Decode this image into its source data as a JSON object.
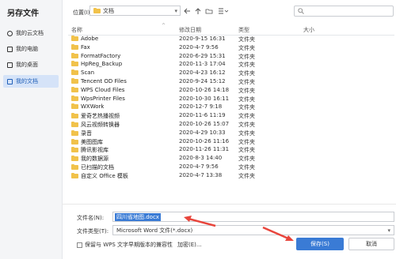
{
  "sidebar": {
    "title": "另存文件",
    "items": [
      {
        "label": "我的云文档",
        "icon": "cloud-doc-icon"
      },
      {
        "label": "我的电脑",
        "icon": "computer-icon"
      },
      {
        "label": "我的桌面",
        "icon": "desktop-icon"
      },
      {
        "label": "我的文档",
        "icon": "folder-icon",
        "active": true
      }
    ]
  },
  "toolbar": {
    "location_label": "位置(I):",
    "location_value": "文档",
    "search_placeholder": ""
  },
  "table": {
    "columns": [
      "名称",
      "修改日期",
      "类型",
      "大小"
    ],
    "rows": [
      {
        "name": "Adobe",
        "date": "2020-9-15 16:31",
        "type": "文件夹"
      },
      {
        "name": "Fax",
        "date": "2020-4-7 9:56",
        "type": "文件夹"
      },
      {
        "name": "FormatFactory",
        "date": "2020-6-29 15:31",
        "type": "文件夹"
      },
      {
        "name": "HpReg_Backup",
        "date": "2020-11-3 17:04",
        "type": "文件夹"
      },
      {
        "name": "Scan",
        "date": "2020-4-23 16:12",
        "type": "文件夹"
      },
      {
        "name": "Tencent OD Files",
        "date": "2020-9-24 15:12",
        "type": "文件夹"
      },
      {
        "name": "WPS Cloud Files",
        "date": "2020-10-26 14:18",
        "type": "文件夹"
      },
      {
        "name": "WpsPrinter Files",
        "date": "2020-10-30 16:11",
        "type": "文件夹"
      },
      {
        "name": "WXWork",
        "date": "2020-12-7 9:18",
        "type": "文件夹"
      },
      {
        "name": "爱奇艺热播视频",
        "date": "2020-11-6 11:19",
        "type": "文件夹"
      },
      {
        "name": "风云视频转换器",
        "date": "2020-10-26 15:07",
        "type": "文件夹"
      },
      {
        "name": "录音",
        "date": "2020-4-29 10:33",
        "type": "文件夹"
      },
      {
        "name": "美图图库",
        "date": "2020-10-26 11:16",
        "type": "文件夹"
      },
      {
        "name": "腾讯影视库",
        "date": "2020-11-26 11:31",
        "type": "文件夹"
      },
      {
        "name": "我的数据源",
        "date": "2020-8-3 14:40",
        "type": "文件夹"
      },
      {
        "name": "已扫描的文档",
        "date": "2020-4-7 9:56",
        "type": "文件夹"
      },
      {
        "name": "自定义 Office 模板",
        "date": "2020-4-7 13:38",
        "type": "文件夹"
      }
    ]
  },
  "form": {
    "filename_label": "文件名(N):",
    "filename_value": "四川省地图.docx",
    "filetype_label": "文件类型(T):",
    "filetype_value": "Microsoft Word 文件(*.docx)",
    "checkbox_label": "保留与 WPS 文字早期版本的兼容性",
    "encrypt_label": "加密(E)...",
    "save_label": "保存(S)",
    "cancel_label": "取消"
  },
  "colors": {
    "accent": "#3a7bd5",
    "annotation_arrow": "#e8453c",
    "folder": "#f1c24b"
  }
}
